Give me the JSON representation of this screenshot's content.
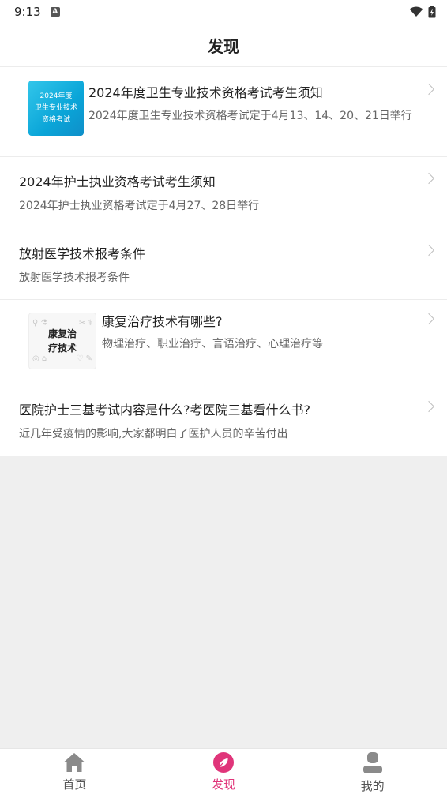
{
  "status_bar": {
    "time": "9:13",
    "notification_icon": "A"
  },
  "header": {
    "title": "发现"
  },
  "articles": [
    {
      "title": "2024年度卫生专业技术资格考试考生须知",
      "subtitle": "2024年度卫生专业技术资格考试定于4月13、14、20、21日举行",
      "thumbnail_text": [
        "2024年度",
        "卫生专业技术",
        "资格考试"
      ]
    },
    {
      "title": "2024年护士执业资格考试考生须知",
      "subtitle": "2024年护士执业资格考试定于4月27、28日举行"
    },
    {
      "title": "放射医学技术报考条件",
      "subtitle": "放射医学技术报考条件"
    },
    {
      "title": "康复治疗技术有哪些?",
      "subtitle": "物理治疗、职业治疗、言语治疗、心理治疗等",
      "thumbnail_text": [
        "康复治",
        "疗技术"
      ]
    },
    {
      "title": "医院护士三基考试内容是什么?考医院三基看什么书?",
      "subtitle": "近几年受疫情的影响,大家都明白了医护人员的辛苦付出"
    }
  ],
  "tabbar": {
    "tabs": [
      {
        "label": "首页",
        "icon": "home-icon"
      },
      {
        "label": "发现",
        "icon": "discover-icon",
        "active": true
      },
      {
        "label": "我的",
        "icon": "profile-icon"
      }
    ]
  },
  "colors": {
    "accent": "#e0357a",
    "icon_gray": "#8a8a8a",
    "background": "#efefef"
  }
}
